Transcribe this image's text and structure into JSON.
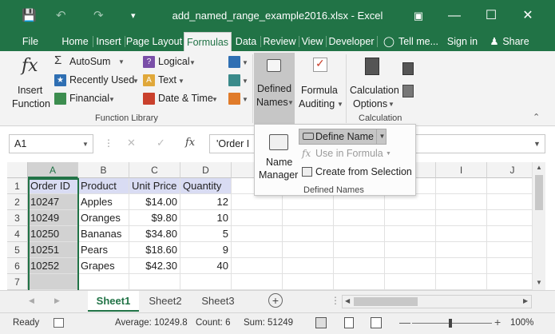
{
  "window": {
    "title": "add_named_range_example2016.xlsx - Excel",
    "accent": "#217346"
  },
  "tabs": [
    {
      "label": "File"
    },
    {
      "label": "Home"
    },
    {
      "label": "Insert"
    },
    {
      "label": "Page Layout"
    },
    {
      "label": "Formulas"
    },
    {
      "label": "Data"
    },
    {
      "label": "Review"
    },
    {
      "label": "View"
    },
    {
      "label": "Developer"
    },
    {
      "label": "Tell me..."
    },
    {
      "label": "Sign in"
    },
    {
      "label": "Share"
    }
  ],
  "ribbon": {
    "insert_function": {
      "line1": "Insert",
      "line2": "Function",
      "glyph": "fx"
    },
    "autosum": "AutoSum",
    "recently_used": "Recently Used",
    "financial": "Financial",
    "logical": "Logical",
    "text": "Text",
    "date_time": "Date & Time",
    "function_library_label": "Function Library",
    "defined_names": {
      "line1": "Defined",
      "line2": "Names"
    },
    "formula_auditing": {
      "line1": "Formula",
      "line2": "Auditing"
    },
    "calculation_options": {
      "line1": "Calculation",
      "line2": "Options"
    },
    "calculation_label": "Calculation"
  },
  "dropdown": {
    "name_manager": {
      "line1": "Name",
      "line2": "Manager"
    },
    "define_name": "Define Name",
    "use_in_formula": "Use in Formula",
    "create_from_selection": "Create from Selection",
    "group_label": "Defined Names"
  },
  "formula_bar": {
    "name_box": "A1",
    "fx": "fx",
    "value": "'Order I"
  },
  "columns": [
    "A",
    "B",
    "C",
    "D",
    "E",
    "F",
    "G",
    "H",
    "I",
    "J"
  ],
  "rows": [
    "1",
    "2",
    "3",
    "4",
    "5",
    "6",
    "7"
  ],
  "table": {
    "headers": [
      "Order ID",
      "Product",
      "Unit Price",
      "Quantity"
    ],
    "data": [
      [
        "10247",
        "Apples",
        "$14.00",
        "12"
      ],
      [
        "10249",
        "Oranges",
        "$9.80",
        "10"
      ],
      [
        "10250",
        "Bananas",
        "$34.80",
        "5"
      ],
      [
        "10251",
        "Pears",
        "$18.60",
        "9"
      ],
      [
        "10252",
        "Grapes",
        "$42.30",
        "40"
      ]
    ]
  },
  "sheets": [
    "Sheet1",
    "Sheet2",
    "Sheet3"
  ],
  "status": {
    "ready": "Ready",
    "average": "Average: 10249.8",
    "count": "Count: 6",
    "sum": "Sum: 51249",
    "zoom": "100%"
  }
}
